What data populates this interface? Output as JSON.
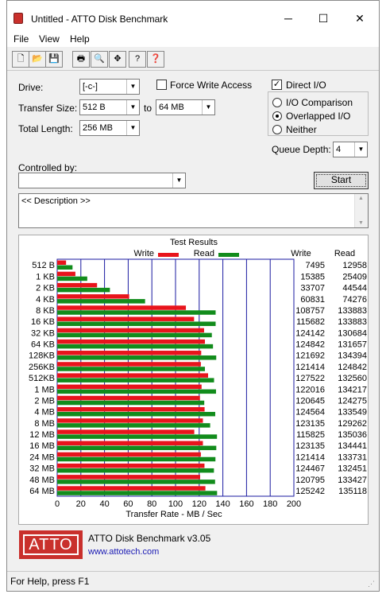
{
  "window": {
    "title": "Untitled - ATTO Disk Benchmark",
    "minimize": "─",
    "maximize": "☐",
    "close": "✕"
  },
  "menu": [
    "File",
    "View",
    "Help"
  ],
  "toolbar": {
    "buttons": [
      {
        "name": "new-icon",
        "glyph": "🗋"
      },
      {
        "name": "open-icon",
        "glyph": "📂"
      },
      {
        "name": "save-icon",
        "glyph": "💾"
      },
      {
        "name": "print-icon",
        "glyph": "🖶"
      },
      {
        "name": "print-preview-icon",
        "glyph": "🔍"
      },
      {
        "name": "move-icon",
        "glyph": "✥"
      },
      {
        "name": "help-icon",
        "glyph": "?"
      },
      {
        "name": "context-help-icon",
        "glyph": "❓"
      }
    ]
  },
  "form": {
    "drive_label": "Drive:",
    "drive_value": "[-c-]",
    "force_write_label": "Force Write Access",
    "direct_io_label": "Direct I/O",
    "transfer_size_label": "Transfer Size:",
    "transfer_from": "512 B",
    "to_label": "to",
    "transfer_to": "64 MB",
    "total_length_label": "Total Length:",
    "total_length": "256 MB",
    "io_comparison": "I/O Comparison",
    "overlapped_io": "Overlapped I/O",
    "neither": "Neither",
    "queue_depth_label": "Queue Depth:",
    "queue_depth": "4",
    "controlled_by_label": "Controlled by:",
    "controlled_by_value": "",
    "start_label": "Start",
    "description": "<< Description >>"
  },
  "results": {
    "title": "Test Results",
    "write_legend": "Write",
    "read_legend": "Read",
    "write_col": "Write",
    "read_col": "Read",
    "xlabel": "Transfer Rate - MB / Sec"
  },
  "colors": {
    "write": "#e8141c",
    "read": "#128c1c",
    "grid": "#1a1aa0",
    "logo": "#c9302c",
    "link": "#1a1ab4"
  },
  "chart_data": {
    "type": "bar",
    "orientation": "horizontal",
    "categories": [
      "512 B",
      "1 KB",
      "2 KB",
      "4 KB",
      "8 KB",
      "16 KB",
      "32 KB",
      "64 KB",
      "128KB",
      "256KB",
      "512KB",
      "1 MB",
      "2 MB",
      "4 MB",
      "8 MB",
      "12 MB",
      "16 MB",
      "24 MB",
      "32 MB",
      "48 MB",
      "64 MB"
    ],
    "series": [
      {
        "name": "Write",
        "values": [
          7495,
          15385,
          33707,
          60831,
          108757,
          115682,
          124142,
          124842,
          121692,
          121414,
          127522,
          122016,
          120645,
          124564,
          123135,
          115825,
          123135,
          121414,
          124467,
          120795,
          125242
        ]
      },
      {
        "name": "Read",
        "values": [
          12958,
          25409,
          44544,
          74276,
          133883,
          133883,
          130684,
          131657,
          134394,
          124842,
          132560,
          134217,
          124275,
          133549,
          129262,
          135036,
          134441,
          133731,
          132451,
          133427,
          135118
        ]
      }
    ],
    "xlabel": "Transfer Rate - MB / Sec",
    "xticks": [
      0,
      20,
      40,
      60,
      80,
      100,
      120,
      140,
      160,
      180,
      200
    ],
    "xlim": [
      0,
      200
    ],
    "units_note": "values in KB/s"
  },
  "footer": {
    "logo_text": "ATTO",
    "product": "ATTO Disk Benchmark v3.05",
    "url": "www.attotech.com"
  },
  "status": "For Help, press F1"
}
